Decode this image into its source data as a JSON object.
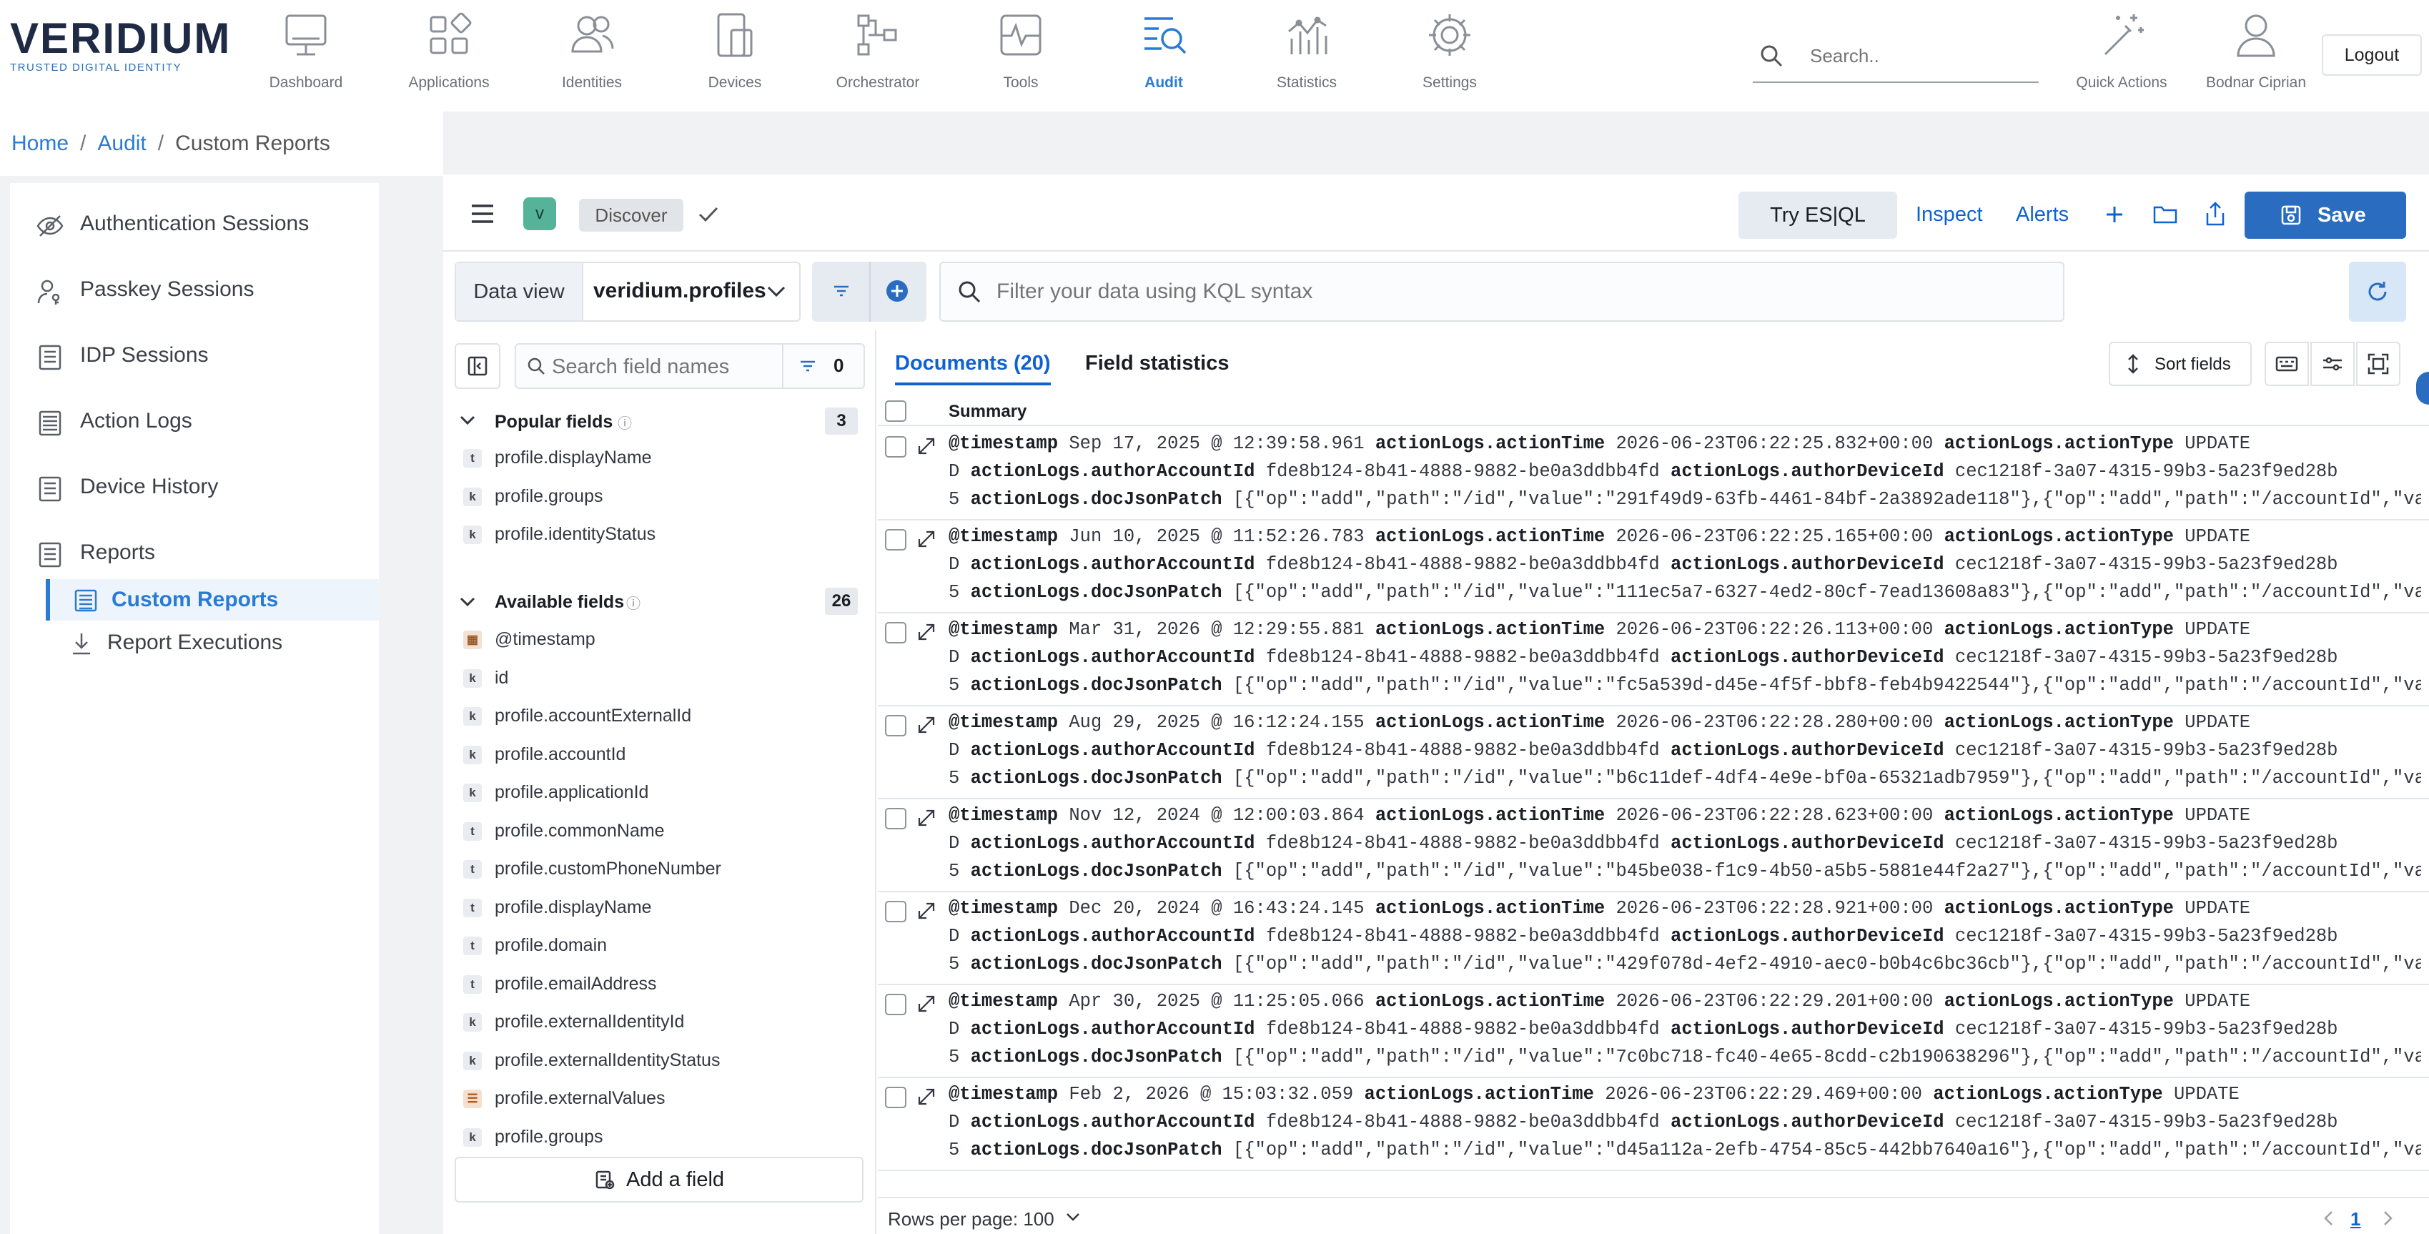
{
  "brand": {
    "name": "VERIDIUM",
    "tagline": "TRUSTED DIGITAL IDENTITY"
  },
  "nav": [
    {
      "label": "Dashboard",
      "icon": "monitor-icon"
    },
    {
      "label": "Applications",
      "icon": "apps-grid-icon"
    },
    {
      "label": "Identities",
      "icon": "users-icon"
    },
    {
      "label": "Devices",
      "icon": "devices-icon"
    },
    {
      "label": "Orchestrator",
      "icon": "workflow-icon"
    },
    {
      "label": "Tools",
      "icon": "pulse-icon"
    },
    {
      "label": "Audit",
      "icon": "audit-search-icon",
      "active": true
    },
    {
      "label": "Statistics",
      "icon": "bar-chart-icon"
    },
    {
      "label": "Settings",
      "icon": "gear-icon"
    }
  ],
  "search": {
    "placeholder": "Search.."
  },
  "quick_actions": "Quick Actions",
  "user": "Bodnar Ciprian",
  "logout": "Logout",
  "breadcrumb": {
    "home": "Home",
    "audit": "Audit",
    "current": "Custom Reports",
    "sep": "/"
  },
  "sidebar": {
    "items": [
      {
        "label": "Authentication Sessions",
        "icon": "eye-slash-icon"
      },
      {
        "label": "Passkey Sessions",
        "icon": "user-key-icon"
      },
      {
        "label": "IDP Sessions",
        "icon": "document-list-icon"
      },
      {
        "label": "Action Logs",
        "icon": "log-list-icon"
      },
      {
        "label": "Device History",
        "icon": "document-list-icon"
      },
      {
        "label": "Reports",
        "icon": "document-list-icon"
      }
    ],
    "sub": [
      {
        "label": "Custom Reports",
        "icon": "report-list-icon",
        "active": true
      },
      {
        "label": "Report Executions",
        "icon": "download-icon"
      }
    ]
  },
  "kibana": {
    "badge": "v",
    "discover": "Discover",
    "try_esql": "Try ES|QL",
    "inspect": "Inspect",
    "alerts": "Alerts",
    "save": "Save",
    "data_view_label": "Data view",
    "data_view_value": "veridium.profiles",
    "kql_placeholder": "Filter your data using KQL syntax",
    "accent": "#2a6cbf"
  },
  "fields": {
    "search_placeholder": "Search field names",
    "filter_count": "0",
    "popular_title": "Popular fields",
    "popular_count": "3",
    "popular": [
      {
        "type": "t",
        "name": "profile.displayName"
      },
      {
        "type": "k",
        "name": "profile.groups"
      },
      {
        "type": "k",
        "name": "profile.identityStatus"
      }
    ],
    "available_title": "Available fields",
    "available_count": "26",
    "available": [
      {
        "type": "cal",
        "name": "@timestamp"
      },
      {
        "type": "k",
        "name": "id"
      },
      {
        "type": "k",
        "name": "profile.accountExternalId"
      },
      {
        "type": "k",
        "name": "profile.accountId"
      },
      {
        "type": "k",
        "name": "profile.applicationId"
      },
      {
        "type": "t",
        "name": "profile.commonName"
      },
      {
        "type": "t",
        "name": "profile.customPhoneNumber"
      },
      {
        "type": "t",
        "name": "profile.displayName"
      },
      {
        "type": "t",
        "name": "profile.domain"
      },
      {
        "type": "t",
        "name": "profile.emailAddress"
      },
      {
        "type": "k",
        "name": "profile.externalIdentityId"
      },
      {
        "type": "k",
        "name": "profile.externalIdentityStatus"
      },
      {
        "type": "obj",
        "name": "profile.externalValues"
      },
      {
        "type": "k",
        "name": "profile.groups"
      }
    ],
    "add_field": "Add a field"
  },
  "docs": {
    "tab_documents": "Documents (20)",
    "tab_field_stats": "Field statistics",
    "sort_fields": "Sort fields",
    "summary_header": "Summary",
    "rows": [
      {
        "ts": "Sep 17, 2025 @ 12:39:58.961",
        "action_time": "2026-06-23T06:22:25.832+00:00",
        "value_id": "291f49d9-63fb-4461-84bf-2a3892ade118"
      },
      {
        "ts": "Jun 10, 2025 @ 11:52:26.783",
        "action_time": "2026-06-23T06:22:25.165+00:00",
        "value_id": "111ec5a7-6327-4ed2-80cf-7ead13608a83"
      },
      {
        "ts": "Mar 31, 2026 @ 12:29:55.881",
        "action_time": "2026-06-23T06:22:26.113+00:00",
        "value_id": "fc5a539d-d45e-4f5f-bbf8-feb4b9422544"
      },
      {
        "ts": "Aug 29, 2025 @ 16:12:24.155",
        "action_time": "2026-06-23T06:22:28.280+00:00",
        "value_id": "b6c11def-4df4-4e9e-bf0a-65321adb7959"
      },
      {
        "ts": "Nov 12, 2024 @ 12:00:03.864",
        "action_time": "2026-06-23T06:22:28.623+00:00",
        "value_id": "b45be038-f1c9-4b50-a5b5-5881e44f2a27"
      },
      {
        "ts": "Dec 20, 2024 @ 16:43:24.145",
        "action_time": "2026-06-23T06:22:28.921+00:00",
        "value_id": "429f078d-4ef2-4910-aec0-b0b4c6bc36cb"
      },
      {
        "ts": "Apr 30, 2025 @ 11:25:05.066",
        "action_time": "2026-06-23T06:22:29.201+00:00",
        "value_id": "7c0bc718-fc40-4e65-8cdd-c2b190638296"
      },
      {
        "ts": "Feb 2, 2026 @ 15:03:32.059",
        "action_time": "2026-06-23T06:22:29.469+00:00",
        "value_id": "d45a112a-2efb-4754-85c5-442bb7640a16"
      }
    ],
    "k_timestamp": "@timestamp",
    "k_action_time": "actionLogs.actionTime",
    "k_action_type": "actionLogs.actionType",
    "v_action_type": "UPDATE",
    "k_author_account": "actionLogs.authorAccountId",
    "v_author_account": "fde8b124-8b41-4888-9882-be0a3ddbb4fd",
    "k_author_device": "actionLogs.authorDeviceId",
    "v_author_device": "cec1218f-3a07-4315-99b3-5a23f9ed28b",
    "k_doc_patch": "actionLogs.docJsonPatch",
    "patch_prefix": "[{\"op\":\"add\",\"path\":\"/id\",\"value\":\"",
    "patch_suffix": "\"},{\"op\":\"add\",\"path\":\"/accountId\",\"valu…",
    "line2_prefix": "D",
    "line3_prefix": "5",
    "rows_per_page": "Rows per page: 100",
    "page": "1"
  }
}
